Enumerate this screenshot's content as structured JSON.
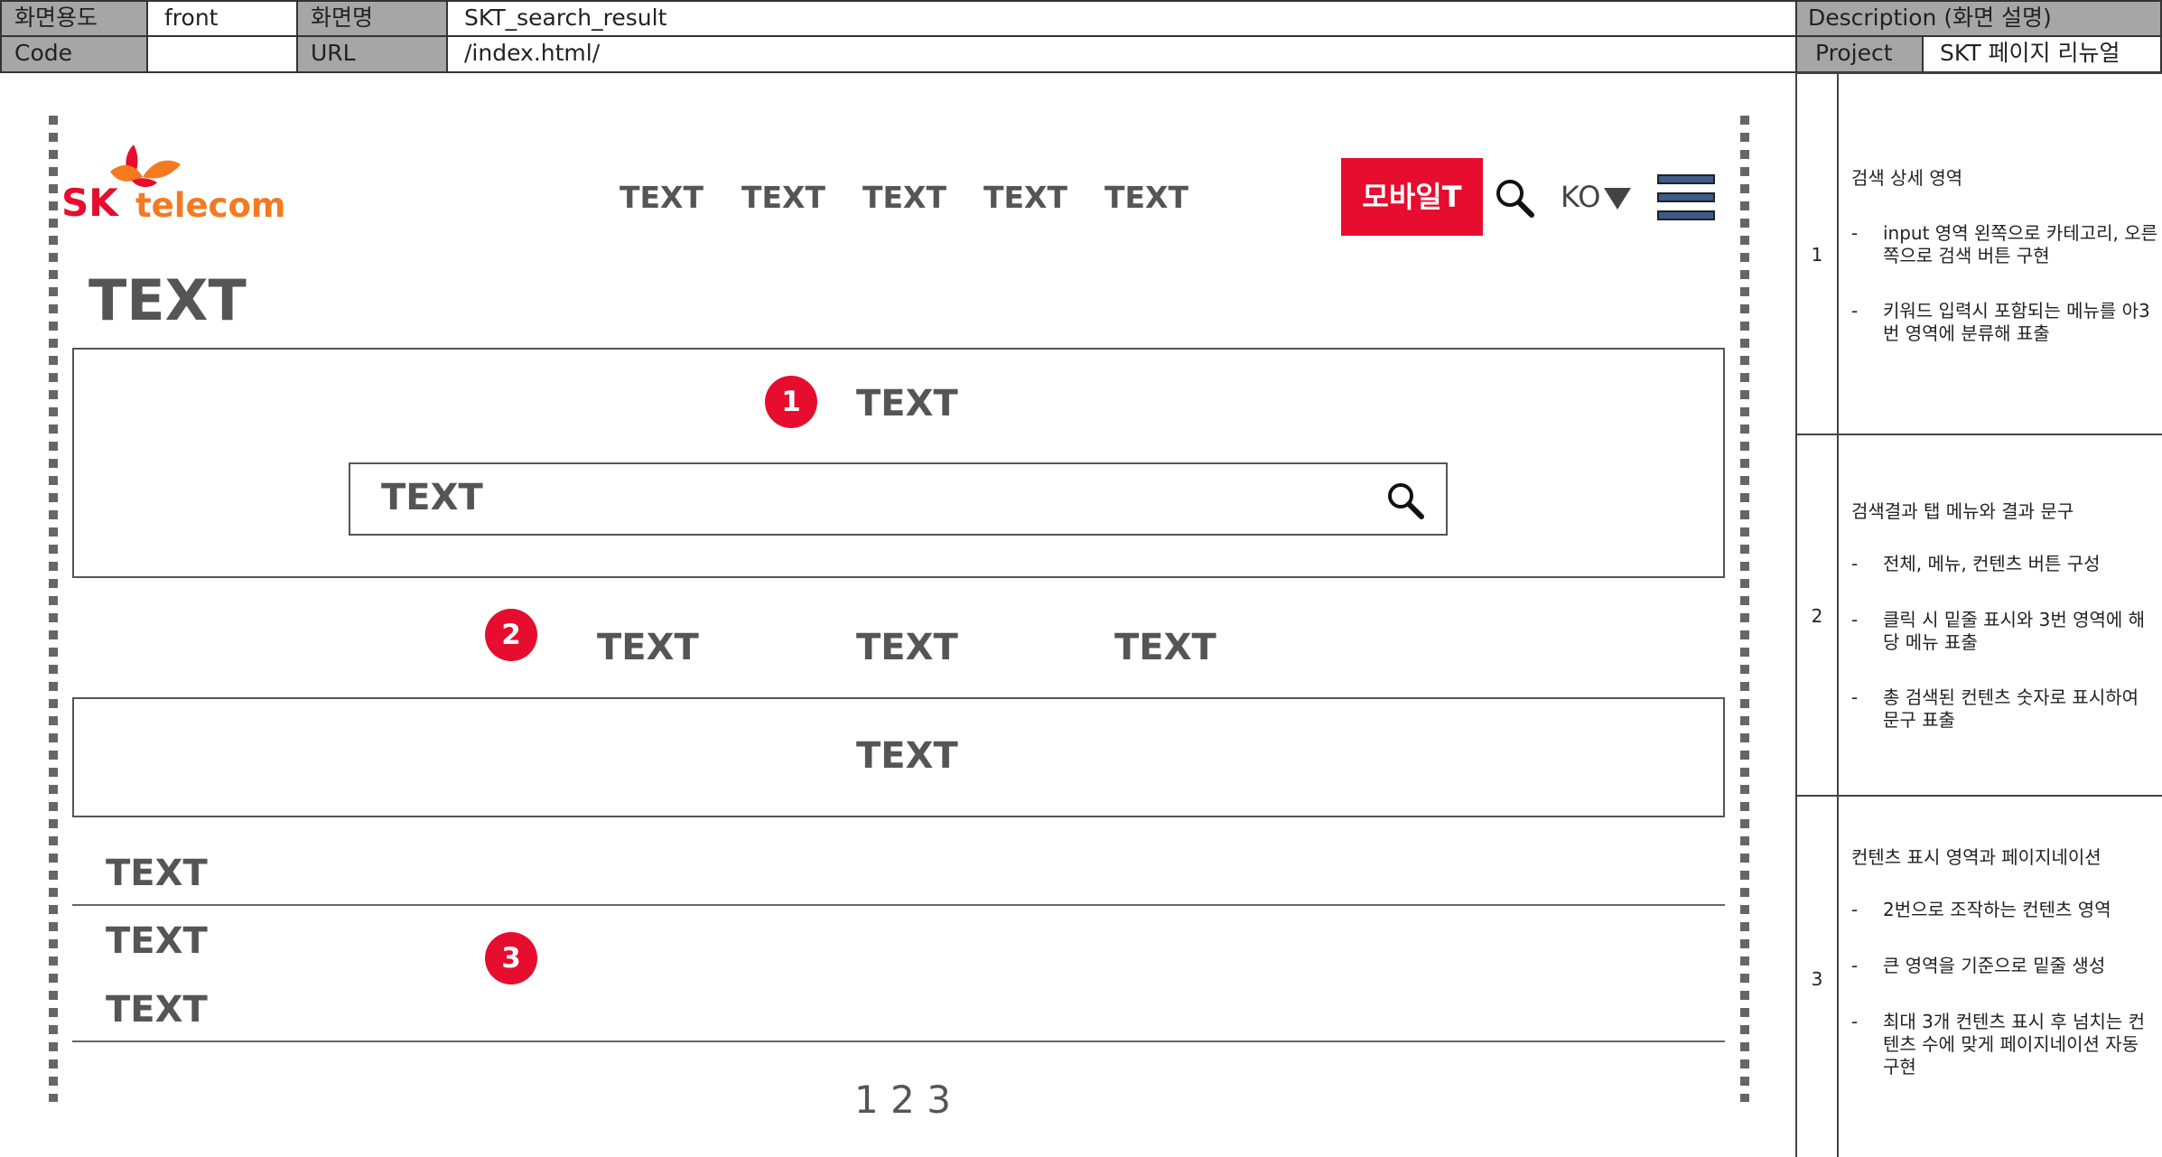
{
  "header": {
    "screen_type_label": "화면용도",
    "screen_type_value": "front",
    "screen_name_label": "화면명",
    "screen_name_value": "SKT_search_result",
    "code_label": "Code",
    "code_value": "",
    "url_label": "URL",
    "url_value": "/index.html/",
    "description_label": "Description (화면 설명)",
    "project_label": "Project",
    "project_value": "SKT 페이지 리뉴얼"
  },
  "descriptions": [
    {
      "number": "1",
      "title": "검색 상세 영역",
      "items": [
        "input 영역 왼쪽으로 카테고리, 오른쪽으로 검색 버튼 구현",
        "키워드 입력시 포함되는 메뉴를 아3번 영역에 분류해 표출"
      ]
    },
    {
      "number": "2",
      "title": "검색결과 탭 메뉴와 결과 문구",
      "items": [
        "전체, 메뉴, 컨텐츠 버튼 구성",
        "클릭 시 밑줄 표시와 3번 영역에 해당 메뉴 표출",
        "총 검색된 컨텐츠 숫자로 표시하여 문구 표출"
      ]
    },
    {
      "number": "3",
      "title": "컨텐츠 표시 영역과 페이지네이션",
      "items": [
        "2번으로 조작하는 컨텐츠 영역",
        "큰 영역을 기준으로 밑줄 생성",
        "최대 3개 컨텐츠 표시 후 넘치는 컨텐츠 수에 맞게 페이지네이션 자동 구현"
      ]
    }
  ],
  "wireframe": {
    "logo": {
      "sk": "SK",
      "telecom": "telecom"
    },
    "nav_items": [
      "TEXT",
      "TEXT",
      "TEXT",
      "TEXT",
      "TEXT"
    ],
    "mobile_button": "모바일T",
    "language": "KO",
    "page_title": "TEXT",
    "section1": {
      "badge": "1",
      "heading": "TEXT",
      "search_value": "TEXT"
    },
    "section2": {
      "badge": "2",
      "tabs": [
        "TEXT",
        "TEXT",
        "TEXT"
      ],
      "result_text": "TEXT"
    },
    "section3": {
      "badge": "3",
      "items": [
        "TEXT",
        "TEXT",
        "TEXT"
      ]
    },
    "pagination": [
      "1",
      "2",
      "3"
    ]
  },
  "colors": {
    "accent_red": "#e60d2e",
    "logo_orange": "#f47a20",
    "menu_blue": "#3d5a8a"
  }
}
